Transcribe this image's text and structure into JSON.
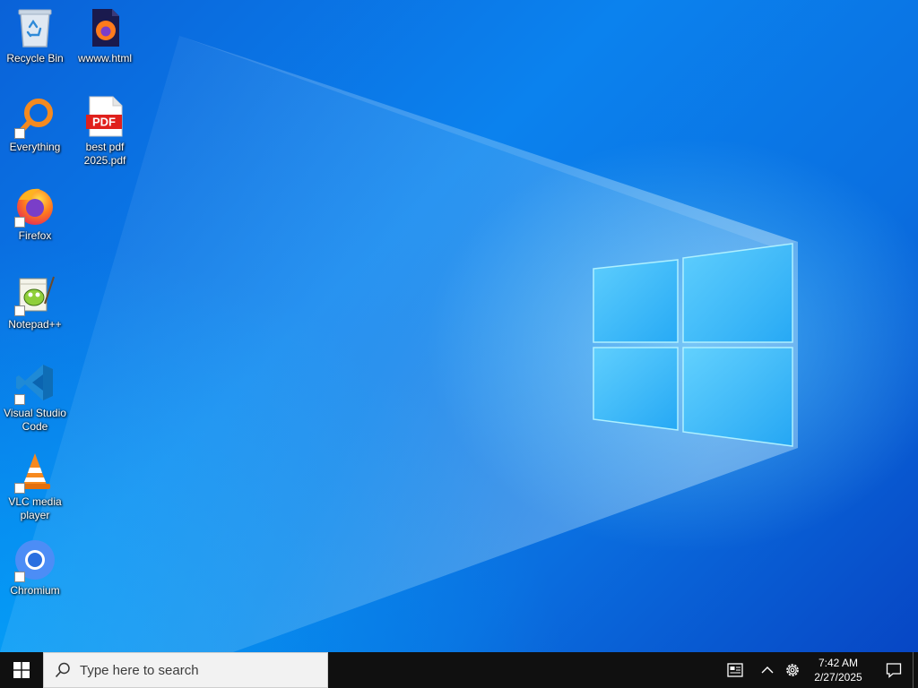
{
  "desktop": {
    "icons": [
      {
        "label": "Recycle Bin",
        "icon": "recycle-bin-icon"
      },
      {
        "label": "wwww.html",
        "icon": "firefox-html-file-icon"
      },
      {
        "label": "Everything",
        "icon": "everything-search-icon"
      },
      {
        "label": "best pdf 2025.pdf",
        "icon": "pdf-file-icon",
        "badge": "PDF"
      },
      {
        "label": "Firefox",
        "icon": "firefox-icon"
      },
      {
        "label": "Notepad++",
        "icon": "notepadpp-icon"
      },
      {
        "label": "Visual Studio Code",
        "icon": "vscode-icon"
      },
      {
        "label": "VLC media player",
        "icon": "vlc-icon"
      },
      {
        "label": "Chromium",
        "icon": "chromium-icon"
      }
    ],
    "accent_color": "#0a78e8"
  },
  "taskbar": {
    "start_icon": "windows-start-icon",
    "search_placeholder": "Type here to search",
    "search_icon": "search-icon",
    "tray": {
      "widgets_icon": "news-widget-icon",
      "chevron_icon": "chevron-up-icon",
      "settings_icon": "gear-icon",
      "time": "7:42 AM",
      "date": "2/27/2025",
      "notification_icon": "action-center-icon"
    }
  }
}
